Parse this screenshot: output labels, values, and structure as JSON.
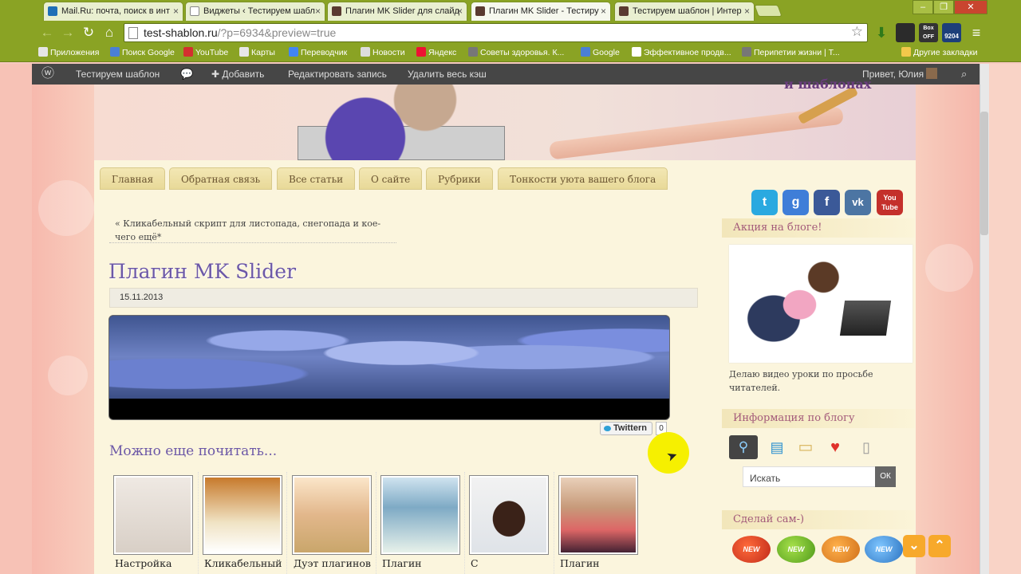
{
  "browser": {
    "tabs": [
      {
        "title": "Mail.Ru: почта, поиск в инт",
        "icon": "mailru-icon"
      },
      {
        "title": "Виджеты ‹ Тестируем шабл",
        "icon": "page-icon"
      },
      {
        "title": "Плагин MK Slider для слайд",
        "icon": "site-favicon-icon"
      },
      {
        "title": "Плагин MK Slider - Тестиру",
        "icon": "site-favicon-icon",
        "active": true
      },
      {
        "title": "Тестируем шаблон | Интер",
        "icon": "site-favicon-icon"
      }
    ],
    "address": {
      "host": "test-shablon.ru",
      "path": "/?p=6934&preview=true"
    },
    "extensions": {
      "box_off": "Box OFF",
      "counter": "9204"
    },
    "bookmarks": [
      {
        "label": "Приложения",
        "icon": "apps-icon"
      },
      {
        "label": "Поиск Google",
        "icon": "google-icon"
      },
      {
        "label": "YouTube",
        "icon": "youtube-icon"
      },
      {
        "label": "Карты",
        "icon": "maps-icon"
      },
      {
        "label": "Переводчик",
        "icon": "translate-icon"
      },
      {
        "label": "Новости",
        "icon": "news-icon"
      },
      {
        "label": "Яндекс",
        "icon": "yandex-icon"
      },
      {
        "label": "Советы здоровья. К...",
        "icon": "site-icon"
      },
      {
        "label": "Google",
        "icon": "google-icon"
      },
      {
        "label": "Эффективное продв...",
        "icon": "page-icon"
      },
      {
        "label": "Перипетии жизни | Т...",
        "icon": "site-icon"
      },
      {
        "label": "Другие закладки",
        "icon": "folder-icon"
      }
    ]
  },
  "adminbar": {
    "site_name": "Тестируем шаблон",
    "add": "Добавить",
    "edit": "Редактировать запись",
    "clear_cache": "Удалить весь кэш",
    "greeting": "Привет, Юлия"
  },
  "header": {
    "text": "и шаблонах"
  },
  "menu": [
    "Главная",
    "Обратная связь",
    "Все статьи",
    "О сайте",
    "Рубрики",
    "Тонкости уюта вашего блога"
  ],
  "social": [
    {
      "name": "twitter-icon",
      "color": "#2aa9e0",
      "glyph": "t"
    },
    {
      "name": "google-icon",
      "color": "#3f7ed8",
      "glyph": "g"
    },
    {
      "name": "facebook-icon",
      "color": "#3b5998",
      "glyph": "f"
    },
    {
      "name": "vkontakte-icon",
      "color": "#4c75a3",
      "glyph": "vk"
    },
    {
      "name": "youtube-icon",
      "color": "#c4302b",
      "glyph": "You Tube"
    }
  ],
  "post": {
    "prev_link": "« Кликабельный скрипт для листопада, снегопада и кое-чего ещё*",
    "title": "Плагин MK Slider",
    "date": "15.11.2013",
    "twitter_label": "Twittern",
    "twitter_count": "0"
  },
  "related": {
    "heading": "Можно еще почитать...",
    "items": [
      "Настройка",
      "Кликабельный",
      "Дуэт плагинов",
      "Плагин",
      "С",
      "Плагин"
    ]
  },
  "sidebar": {
    "promo_title": "Акция на блоге!",
    "promo_text": "Делаю видео уроки по просьбе читателей.",
    "info_title": "Информация по блогу",
    "search_placeholder": "Искать",
    "search_button": "ОК",
    "diy_title": "Сделай сам-)",
    "new_badge": "NEW"
  }
}
